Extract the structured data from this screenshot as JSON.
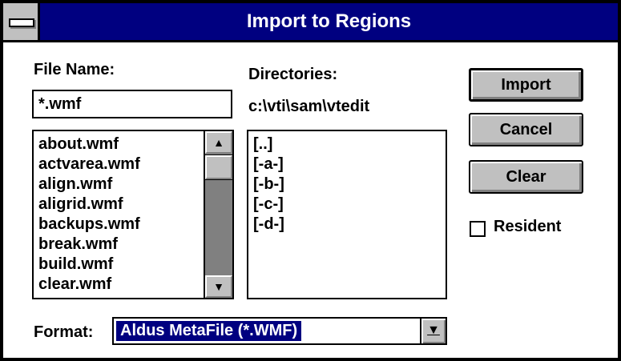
{
  "window": {
    "title": "Import to Regions"
  },
  "file_name": {
    "label": "File Name:",
    "value": "*.wmf"
  },
  "files": {
    "items": [
      "about.wmf",
      "actvarea.wmf",
      "align.wmf",
      "aligrid.wmf",
      "backups.wmf",
      "break.wmf",
      "build.wmf",
      "clear.wmf"
    ]
  },
  "directories": {
    "label": "Directories:",
    "path": "c:\\vti\\sam\\vtedit",
    "items": [
      "[..]",
      "[-a-]",
      "[-b-]",
      "[-c-]",
      "[-d-]"
    ]
  },
  "buttons": {
    "import": "Import",
    "cancel": "Cancel",
    "clear": "Clear"
  },
  "resident": {
    "label": "Resident",
    "checked": false
  },
  "format": {
    "label": "Format:",
    "selected": "Aldus MetaFile (*.WMF)"
  },
  "icons": {
    "system_menu": "system-menu-icon",
    "scroll_up": "arrow-up-icon",
    "scroll_down": "arrow-down-icon",
    "dropdown": "dropdown-arrow-icon"
  },
  "colors": {
    "title_bar": "#000080",
    "selection": "#000080",
    "button_face": "#c0c0c0",
    "scroll_track": "#808080"
  }
}
